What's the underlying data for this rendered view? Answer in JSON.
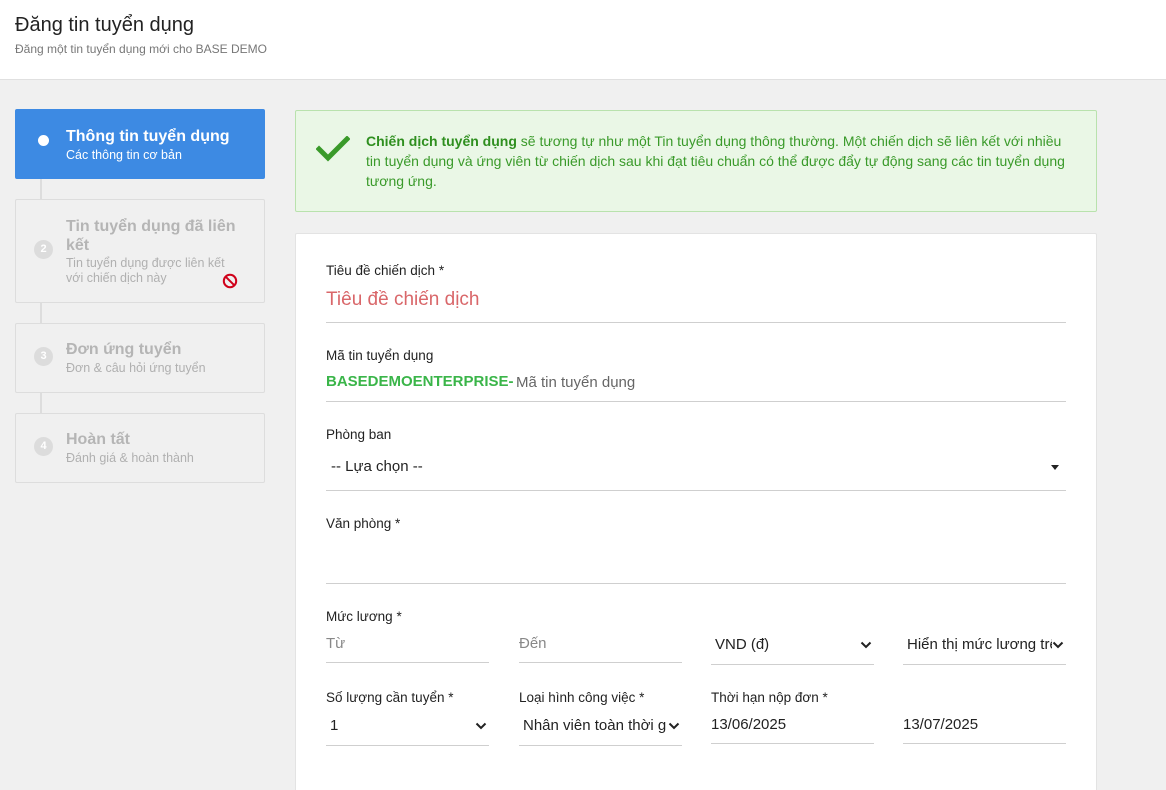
{
  "header": {
    "title": "Đăng tin tuyển dụng",
    "subtitle": "Đăng một tin tuyển dụng mới cho BASE DEMO"
  },
  "steps": [
    {
      "number": "1",
      "label": "Thông tin tuyển dụng",
      "desc": "Các thông tin cơ bản",
      "active": true
    },
    {
      "number": "2",
      "label": "Tin tuyển dụng đã liên kết",
      "desc": "Tin tuyển dụng được liên kết với chiến dịch này",
      "icon": "no-entry-icon"
    },
    {
      "number": "3",
      "label": "Đơn ứng tuyển",
      "desc": "Đơn & câu hỏi ứng tuyển"
    },
    {
      "number": "4",
      "label": "Hoàn tất",
      "desc": "Đánh giá & hoàn thành"
    }
  ],
  "notice": {
    "strong": "Chiến dịch tuyển dụng",
    "text": " sẽ tương tự như một Tin tuyển dụng thông thường. Một chiến dịch sẽ liên kết với nhiều tin tuyển dụng và ứng viên từ chiến dịch sau khi đạt tiêu chuẩn có thể được đẩy tự động sang các tin tuyển dụng tương ứng.",
    "icon": "check-icon",
    "color": "#3a9a2a"
  },
  "form": {
    "title_label": "Tiêu đề chiến dịch *",
    "title_placeholder": "Tiêu đề chiến dịch",
    "code_label": "Mã tin tuyển dụng",
    "code_prefix": "BASEDEMOENTERPRISE-",
    "code_placeholder": "Mã tin tuyển dụng",
    "department_label": "Phòng ban",
    "department_value": "-- Lựa chọn --",
    "office_label": "Văn phòng *",
    "salary_label": "Mức lương *",
    "salary_from_placeholder": "Từ",
    "salary_to_placeholder": "Đến",
    "currency_value": "VND (đ)",
    "salary_display_value": "Hiển thị mức lương trên",
    "quantity_label": "Số lượng cần tuyển *",
    "quantity_value": "1",
    "job_type_label": "Loại hình công việc *",
    "job_type_value": "Nhân viên toàn thời gian",
    "deadline_label": "Thời hạn nộp đơn *",
    "deadline_start": "13/06/2025",
    "deadline_end": "13/07/2025"
  },
  "colors": {
    "accent": "#3d8ae3",
    "success": "#3ab549",
    "error_placeholder": "#d9676a"
  }
}
